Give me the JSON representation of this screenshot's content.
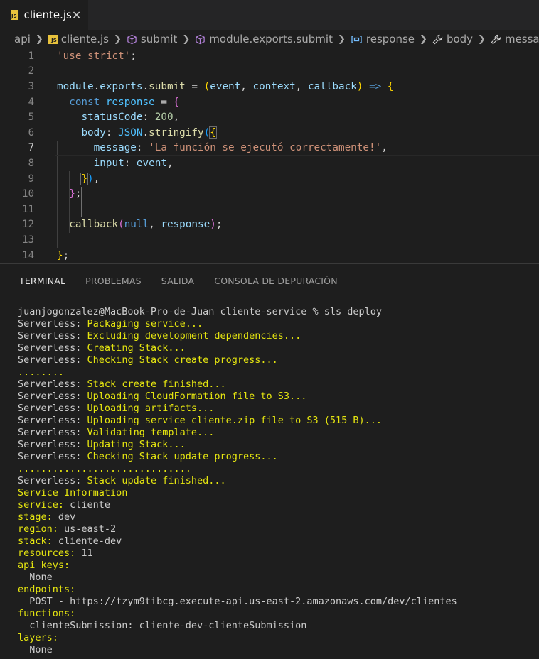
{
  "tab": {
    "badge": "JS",
    "label": "cliente.js",
    "close": "✕"
  },
  "breadcrumb": {
    "root": "api",
    "file": "cliente.js",
    "symbols": [
      "submit",
      "module.exports.submit",
      "response",
      "body",
      "message"
    ]
  },
  "editor": {
    "line_numbers": [
      "1",
      "2",
      "3",
      "4",
      "5",
      "6",
      "7",
      "8",
      "9",
      "10",
      "11",
      "12",
      "13",
      "14"
    ],
    "active_line": "7"
  },
  "panel": {
    "tabs": [
      "TERMINAL",
      "PROBLEMAS",
      "SALIDA",
      "CONSOLA DE DEPURACIÓN"
    ]
  },
  "terminal": {
    "lines": [
      {
        "a": "juanjogonzalez@MacBook-Pro-de-Juan cliente-service % sls deploy",
        "b": ""
      },
      {
        "a": "Serverless: ",
        "b": "Packaging service..."
      },
      {
        "a": "Serverless: ",
        "b": "Excluding development dependencies..."
      },
      {
        "a": "Serverless: ",
        "b": "Creating Stack..."
      },
      {
        "a": "Serverless: ",
        "b": "Checking Stack create progress..."
      },
      {
        "a": "",
        "b": "........"
      },
      {
        "a": "Serverless: ",
        "b": "Stack create finished..."
      },
      {
        "a": "Serverless: ",
        "b": "Uploading CloudFormation file to S3..."
      },
      {
        "a": "Serverless: ",
        "b": "Uploading artifacts..."
      },
      {
        "a": "Serverless: ",
        "b": "Uploading service cliente.zip file to S3 (515 B)..."
      },
      {
        "a": "Serverless: ",
        "b": "Validating template..."
      },
      {
        "a": "Serverless: ",
        "b": "Updating Stack..."
      },
      {
        "a": "Serverless: ",
        "b": "Checking Stack update progress..."
      },
      {
        "a": "",
        "b": ".............................."
      },
      {
        "a": "Serverless: ",
        "b": "Stack update finished..."
      },
      {
        "a": "",
        "b": "Service Information"
      },
      {
        "y": "service:",
        "w": " cliente"
      },
      {
        "y": "stage:",
        "w": " dev"
      },
      {
        "y": "region:",
        "w": " us-east-2"
      },
      {
        "y": "stack:",
        "w": " cliente-dev"
      },
      {
        "y": "resources:",
        "w": " 11"
      },
      {
        "y": "api keys:",
        "w": ""
      },
      {
        "y": "",
        "w": "  None"
      },
      {
        "y": "endpoints:",
        "w": ""
      },
      {
        "y": "",
        "w": "  POST - https://tzym9tibcg.execute-api.us-east-2.amazonaws.com/dev/clientes"
      },
      {
        "y": "functions:",
        "w": ""
      },
      {
        "y": "",
        "w": "  clienteSubmission: cliente-dev-clienteSubmission"
      },
      {
        "y": "layers:",
        "w": ""
      },
      {
        "y": "",
        "w": "  None"
      }
    ]
  },
  "colors": {
    "editor_bg": "#1e1e1e",
    "tab_bar_bg": "#252526",
    "terminal_yellow": "#e5e510",
    "js_badge": "#e8c23c"
  }
}
